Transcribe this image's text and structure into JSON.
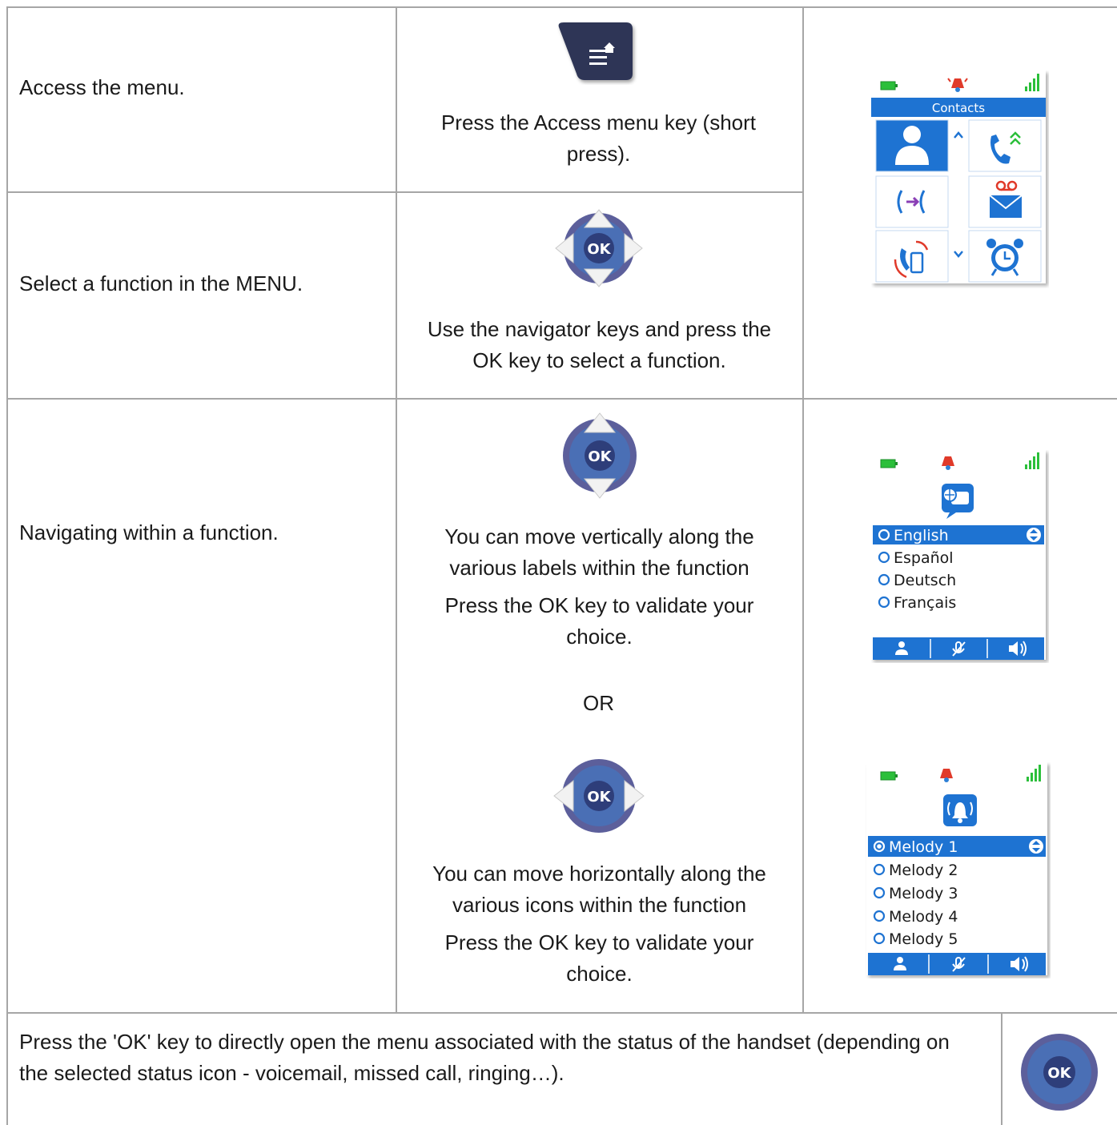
{
  "rows": [
    {
      "action": "Access the menu.",
      "instruction": "Press the Access menu key (short press).",
      "key_icon": "access-menu-key-icon"
    },
    {
      "action": "Select a function in the MENU.",
      "instruction": "Use the navigator keys and press the OK key to select a function.",
      "key_icon": "navigator-4way-ok-icon",
      "key_label": "OK"
    },
    {
      "action": "Navigating within a function.",
      "vertical_instruction": "You can move vertically along the various labels within the function",
      "vertical_validate": "Press the OK key to validate your choice.",
      "or_label": "OR",
      "horizontal_instruction": "You can move horizontally along the various icons within the function",
      "horizontal_validate": "Press the OK key to validate your choice.",
      "vertical_key_label": "OK",
      "horizontal_key_label": "OK"
    }
  ],
  "footer": {
    "text": "Press the 'OK' key to directly open the menu associated with the status of the handset (depending on the selected status icon - voicemail, missed call, ringing…).",
    "key_label": "OK"
  },
  "screens": {
    "menu": {
      "title": "Contacts",
      "status_icons": [
        "battery-icon",
        "alarm-bell-icon",
        "signal-icon"
      ],
      "tiles": [
        "contacts-icon",
        "call-log-icon",
        "transfer-icon",
        "voicemail-icon",
        "intercom-handset-icon",
        "alarm-clock-icon"
      ]
    },
    "language": {
      "header_icon": "language-globe-icon",
      "options": [
        "English",
        "Español",
        "Deutsch",
        "Français"
      ],
      "selected": "English",
      "softkeys": [
        "contacts-icon",
        "mute-icon",
        "speaker-icon"
      ]
    },
    "melody": {
      "header_icon": "ringer-bell-icon",
      "options": [
        "Melody 1",
        "Melody 2",
        "Melody 3",
        "Melody 4",
        "Melody 5"
      ],
      "selected": "Melody 1",
      "softkeys": [
        "contacts-icon",
        "mute-icon",
        "speaker-icon"
      ]
    }
  },
  "colors": {
    "grid_line": "#a6a6a6",
    "screen_blue": "#1e73d2",
    "key_dark": "#2e3657",
    "nav_blue": "#4a6fb5",
    "nav_ring": "#5c5f9b",
    "battery_green": "#2bbf3a",
    "alarm_red": "#e03a2a"
  }
}
